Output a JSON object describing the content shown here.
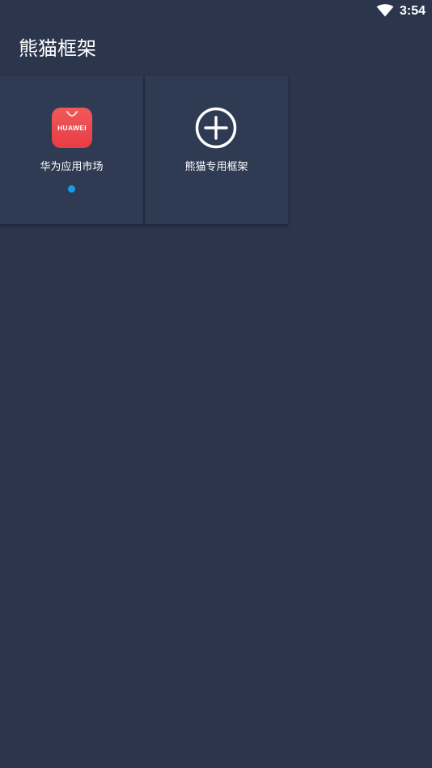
{
  "status_bar": {
    "time": "3:54",
    "wifi_icon": "wifi-icon"
  },
  "header": {
    "title": "熊猫框架"
  },
  "tiles": [
    {
      "label": "华为应用市场",
      "icon": "huawei-appgallery-icon",
      "icon_text": "HUAWEI",
      "icon_color": "#ec4a4f",
      "badge_color": "#1a9bea"
    },
    {
      "label": "熊猫专用框架",
      "icon": "add-circle-icon"
    }
  ],
  "colors": {
    "background": "#2b364c",
    "tile": "#2f3b52",
    "text": "#ffffff"
  }
}
